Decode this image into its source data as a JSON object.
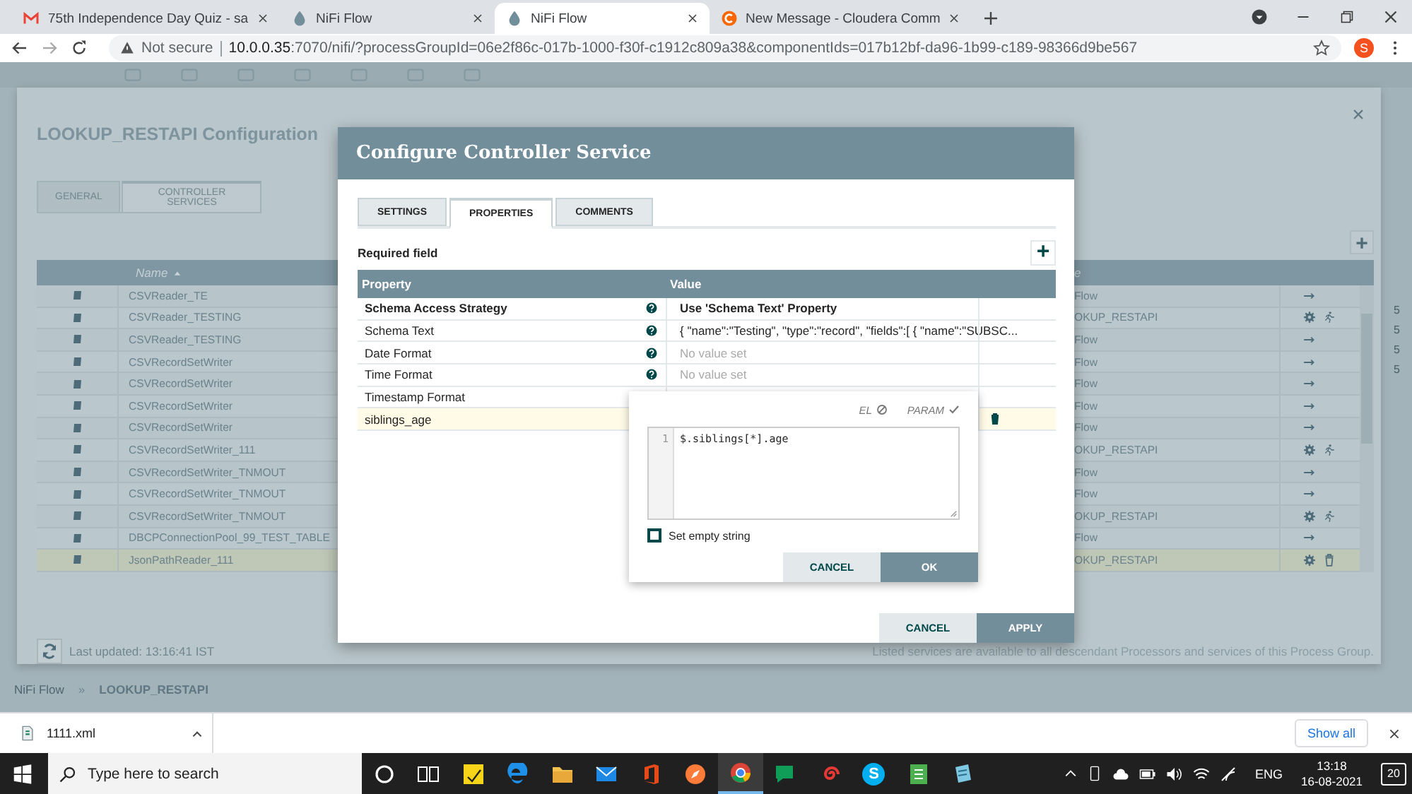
{
  "browser": {
    "tabs": [
      {
        "title": "75th Independence Day Quiz - sa",
        "kind": "mail",
        "selected": false
      },
      {
        "title": "NiFi Flow",
        "kind": "nifi",
        "selected": false
      },
      {
        "title": "NiFi Flow",
        "kind": "nifi",
        "selected": true
      },
      {
        "title": "New Message - Cloudera Comm",
        "kind": "cloudera",
        "selected": false
      }
    ],
    "security": "Not secure",
    "url_host": "10.0.0.35",
    "url_rest": ":7070/nifi/?processGroupId=06e2f86c-017b-1000-f30f-c1912c809a38&componentIds=017b12bf-da96-1b99-c189-98366d9be567",
    "avatar": "S"
  },
  "side_readings": [
    "5",
    "5",
    "5",
    "5"
  ],
  "config": {
    "title": "LOOKUP_RESTAPI Configuration",
    "close": "×",
    "tabs": [
      {
        "label": "GENERAL",
        "selected": false
      },
      {
        "label": "CONTROLLER SERVICES",
        "selected": true
      }
    ],
    "add": "+",
    "columns": [
      "Name",
      "e"
    ],
    "rows": [
      {
        "name": "CSVReader_TE",
        "column_3": "Flow",
        "kind": "inherited",
        "selected": false
      },
      {
        "name": "CSVReader_TESTING",
        "column_3": "OKUP_RESTAPI",
        "kind": "enabled",
        "selected": false
      },
      {
        "name": "CSVReader_TESTING",
        "column_3": "Flow",
        "kind": "inherited",
        "selected": false
      },
      {
        "name": "CSVRecordSetWriter",
        "column_3": "Flow",
        "kind": "inherited",
        "selected": false
      },
      {
        "name": "CSVRecordSetWriter",
        "column_3": "Flow",
        "kind": "inherited",
        "selected": false
      },
      {
        "name": "CSVRecordSetWriter",
        "column_3": "Flow",
        "kind": "inherited",
        "selected": false
      },
      {
        "name": "CSVRecordSetWriter",
        "column_3": "Flow",
        "kind": "inherited",
        "selected": false
      },
      {
        "name": "CSVRecordSetWriter_111",
        "column_3": "OKUP_RESTAPI",
        "kind": "enabled",
        "selected": false
      },
      {
        "name": "CSVRecordSetWriter_TNMOUT",
        "column_3": "Flow",
        "kind": "inherited",
        "selected": false
      },
      {
        "name": "CSVRecordSetWriter_TNMOUT",
        "column_3": "Flow",
        "kind": "inherited",
        "selected": false
      },
      {
        "name": "CSVRecordSetWriter_TNMOUT",
        "column_3": "OKUP_RESTAPI",
        "kind": "enabled",
        "selected": false
      },
      {
        "name": "DBCPConnectionPool_99_TEST_TABLE",
        "column_3": "Flow",
        "kind": "inherited",
        "selected": false
      },
      {
        "name": "JsonPathReader_111",
        "column_3": "OKUP_RESTAPI",
        "kind": "disabled",
        "selected": true
      }
    ],
    "last_updated": "Last updated: 13:16:41 IST",
    "note": "Listed services are available to all descendant Processors and services of this Process Group."
  },
  "breadcrumb": {
    "items": [
      "NiFi Flow",
      "LOOKUP_RESTAPI"
    ],
    "separator": "»"
  },
  "dialog": {
    "title": "Configure Controller Service",
    "tabs": [
      {
        "label": "SETTINGS",
        "selected": false
      },
      {
        "label": "PROPERTIES",
        "selected": true
      },
      {
        "label": "COMMENTS",
        "selected": false
      }
    ],
    "required_label": "Required field",
    "add": "+",
    "columns": [
      "Property",
      "Value"
    ],
    "rows": [
      {
        "property": "Schema Access Strategy",
        "required": true,
        "help": true,
        "value": "Use 'Schema Text' Property",
        "unset": false,
        "deletable": false,
        "selected": false
      },
      {
        "property": "Schema Text",
        "required": false,
        "help": true,
        "value": "{ \"name\":\"Testing\", \"type\":\"record\", \"fields\":[ { \"name\":\"SUBSC...",
        "unset": false,
        "deletable": false,
        "selected": false
      },
      {
        "property": "Date Format",
        "required": false,
        "help": true,
        "value": "No value set",
        "unset": true,
        "deletable": false,
        "selected": false
      },
      {
        "property": "Time Format",
        "required": false,
        "help": true,
        "value": "No value set",
        "unset": true,
        "deletable": false,
        "selected": false
      },
      {
        "property": "Timestamp Format",
        "required": false,
        "deletable": false,
        "selected": false
      },
      {
        "property": "siblings_age",
        "required": false,
        "help": false,
        "deletable": true,
        "selected": true
      }
    ],
    "buttons": [
      {
        "label": "CANCEL",
        "kind": "secondary"
      },
      {
        "label": "APPLY",
        "kind": "primary"
      }
    ]
  },
  "editor": {
    "flags": [
      {
        "label": "EL",
        "supported": false
      },
      {
        "label": "PARAM",
        "supported": true
      }
    ],
    "line_number": "1",
    "code": "$.siblings[*].age",
    "empty_label": "Set empty string",
    "empty_checked": false,
    "buttons": [
      {
        "label": "CANCEL",
        "kind": "secondary"
      },
      {
        "label": "OK",
        "kind": "primary"
      }
    ]
  },
  "downloads": {
    "file": "1111.xml",
    "show_all": "Show all"
  },
  "taskbar": {
    "search": "Type here to search",
    "apps": [
      {
        "kind": "ring",
        "selected": false
      },
      {
        "kind": "taskview",
        "selected": false
      },
      {
        "kind": "note",
        "selected": false
      },
      {
        "kind": "edge",
        "selected": false
      },
      {
        "kind": "folder",
        "selected": false
      },
      {
        "kind": "mail",
        "selected": false
      },
      {
        "kind": "office",
        "selected": false
      },
      {
        "kind": "compass",
        "selected": false
      },
      {
        "kind": "chrome",
        "selected": true
      },
      {
        "kind": "chat",
        "selected": false
      },
      {
        "kind": "spiral",
        "selected": false
      },
      {
        "kind": "skype",
        "label": "S",
        "selected": false
      },
      {
        "kind": "sheet",
        "selected": false
      },
      {
        "kind": "notepad",
        "selected": false
      }
    ],
    "language": "ENG",
    "time": "13:18",
    "date": "16-08-2021",
    "notifications": "20"
  }
}
